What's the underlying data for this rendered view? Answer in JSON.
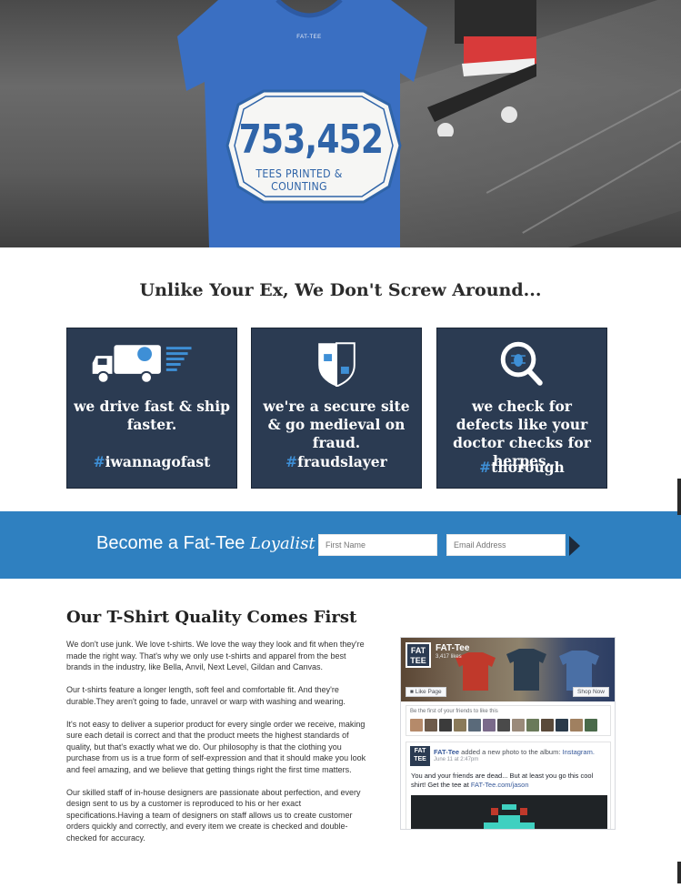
{
  "hero": {
    "brand_tag": "FAT-TEE",
    "count": "753,452",
    "count_caption": "TEES PRINTED & COUNTING"
  },
  "tagline": "Unlike Your Ex, We Don't Screw Around...",
  "features": [
    {
      "icon": "delivery-truck-icon",
      "title": "we drive fast & ship faster.",
      "hashtag": "iwannagofast"
    },
    {
      "icon": "security-shield-icon",
      "title": "we're a secure site & go medieval on fraud.",
      "hashtag": "fraudslayer"
    },
    {
      "icon": "magnifier-bug-icon",
      "title": "we check for defects like your doctor checks for herpes.",
      "hashtag": "thorough"
    }
  ],
  "signup": {
    "label": "Become a Fat-Tee",
    "label_script": "Loyalist",
    "first_name_placeholder": "First Name",
    "email_placeholder": "Email Address",
    "accent": "#2f80c0"
  },
  "quality": {
    "heading": "Our T-Shirt Quality Comes First",
    "paragraphs": [
      "We don't use junk. We love t-shirts. We love the way they look and fit when they're made the right way. That's why we only use t-shirts and apparel from the best brands in the industry, like Bella, Anvil, Next Level, Gildan and Canvas.",
      "Our t-shirts feature a longer length, soft feel and comfortable fit. And they're durable.They aren't going to fade, unravel or warp with washing and wearing.",
      "It's not easy to deliver a superior product for every single order we receive, making sure each detail is correct and that the product meets the highest standards of quality, but that's exactly what we do. Our philosophy is that the clothing you purchase from us is a true form of self-expression and that it should make you look and feel amazing, and we believe that getting things right the first time matters.",
      "Our skilled staff of in-house designers are passionate about perfection, and every design sent to us by a customer is reproduced to his or her exact specifications.Having a team of designers on staff allows us to create customer orders quickly and correctly, and every item we create is checked and double-checked for accuracy."
    ]
  },
  "facebook": {
    "logo_text": "FAT TEE",
    "page_name": "FAT-Tee",
    "likes": "3,417 likes",
    "like_button": "Like Page",
    "shop_button": "Shop Now",
    "friends_text": "Be the first of your friends to like this",
    "post_author": "FAT-Tee",
    "post_action": "added a new photo to the album:",
    "post_album": "Instagram.",
    "post_date": "June 11 at 2:47pm",
    "post_text": "You and your friends are dead... But at least you go this cool shirt! Get the tee at",
    "post_link": "FAT-Tee.com/jason"
  }
}
